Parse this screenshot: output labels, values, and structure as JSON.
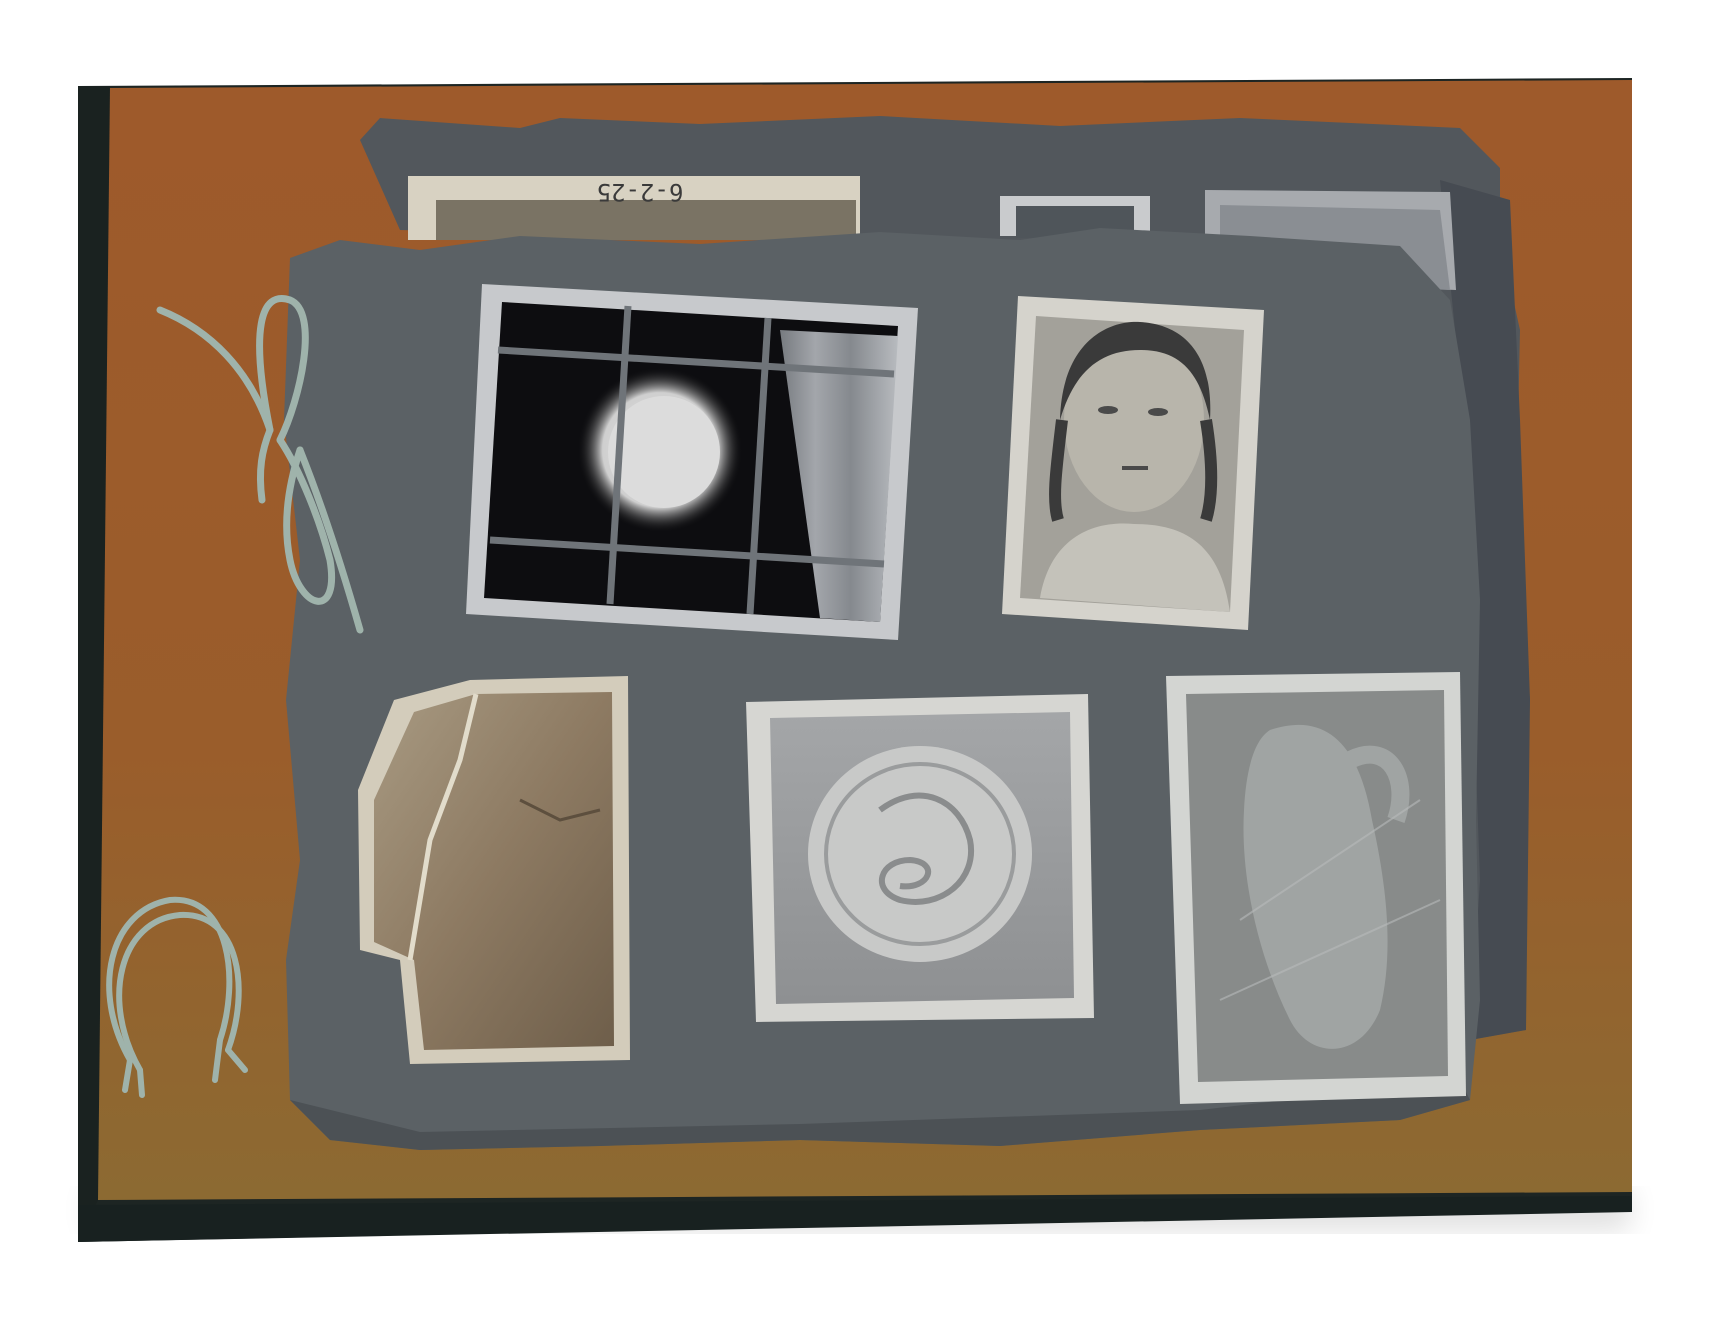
{
  "artwork": {
    "inscription": "6-2-25",
    "colors": {
      "ochre": "#a45c2a",
      "ochre_dark": "#7a4a26",
      "slate": "#5b6165",
      "slate_dark": "#464b50",
      "frame_dark": "#1d2523",
      "paper_cream": "#d8d2c2",
      "string": "#9fb3ab"
    }
  }
}
